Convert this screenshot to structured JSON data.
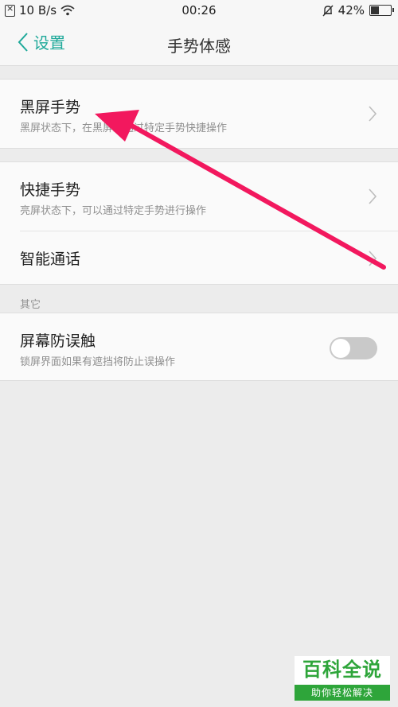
{
  "status_bar": {
    "network_speed": "10 B/s",
    "time": "00:26",
    "battery": "42%",
    "icons": [
      "sim-icon",
      "wifi-icon",
      "mute-bell-icon",
      "battery-icon"
    ]
  },
  "nav": {
    "back_label": "设置",
    "title": "手势体感"
  },
  "gesture_group_1": {
    "items": [
      {
        "title": "黑屏手势",
        "subtitle": "黑屏状态下，在黑屏上通过特定手势快捷操作"
      }
    ]
  },
  "gesture_group_2": {
    "items": [
      {
        "title": "快捷手势",
        "subtitle": "亮屏状态下，可以通过特定手势进行操作"
      },
      {
        "title": "智能通话"
      }
    ]
  },
  "other_section": {
    "label": "其它",
    "items": [
      {
        "title": "屏幕防误触",
        "subtitle": "锁屏界面如果有遮挡将防止误操作",
        "toggle_on": false
      }
    ]
  },
  "annotation": {
    "color": "#f2185e"
  },
  "watermark": {
    "title": "百科全说",
    "subtitle": "助你轻松解决"
  },
  "colors": {
    "accent": "#1fa99a",
    "background": "#ececec"
  }
}
